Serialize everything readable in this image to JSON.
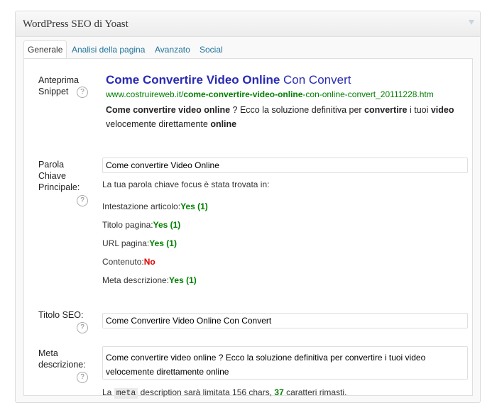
{
  "header": {
    "title": "WordPress SEO di Yoast"
  },
  "tabs": [
    {
      "label": "Generale"
    },
    {
      "label": "Analisi della pagina"
    },
    {
      "label": "Avanzato"
    },
    {
      "label": "Social"
    }
  ],
  "help_glyph": "?",
  "snippet": {
    "label_line1": "Anteprima",
    "label_line2": "Snippet",
    "title_bold": "Come Convertire Video Online",
    "title_rest": " Con Convert",
    "url_prefix": "www.costruireweb.it/",
    "url_bold": "come-convertire-video-online",
    "url_suffix": "-con-online-convert_20111228.htm",
    "desc_b1": "Come convertire video online",
    "desc_t1": " ? Ecco la soluzione definitiva per ",
    "desc_b2": "convertire",
    "desc_t2": " i tuoi ",
    "desc_b3": "video",
    "desc_t3": " velocemente direttamente ",
    "desc_b4": "online"
  },
  "keyword": {
    "label_line1": "Parola",
    "label_line2": "Chiave",
    "label_line3": "Principale:",
    "value": "Come convertire Video Online",
    "found_text": "La tua parola chiave focus è stata trovata in:",
    "checks": [
      {
        "label": "Intestazione articolo:",
        "result": "Yes (1)",
        "status": "yes"
      },
      {
        "label": "Titolo pagina:",
        "result": "Yes (1)",
        "status": "yes"
      },
      {
        "label": "URL pagina:",
        "result": "Yes (1)",
        "status": "yes"
      },
      {
        "label": "Contenuto:",
        "result": "No",
        "status": "no"
      },
      {
        "label": "Meta descrizione:",
        "result": "Yes (1)",
        "status": "yes"
      }
    ]
  },
  "seo_title": {
    "label": "Titolo SEO:",
    "value": "Come Convertire Video Online Con Convert"
  },
  "meta_desc": {
    "label_line1": "Meta",
    "label_line2": "descrizione:",
    "value": "Come convertire video online ? Ecco la soluzione definitiva per convertire i tuoi video velocemente direttamente online",
    "note_pre": "La ",
    "note_code": "meta",
    "note_mid": " description sarà limitata 156 chars, ",
    "note_count": "37",
    "note_post": " caratteri rimasti."
  },
  "colors": {
    "link": "#21759b",
    "snippet_title": "#2a2ab3",
    "success": "#008000",
    "error": "#dc0000"
  }
}
